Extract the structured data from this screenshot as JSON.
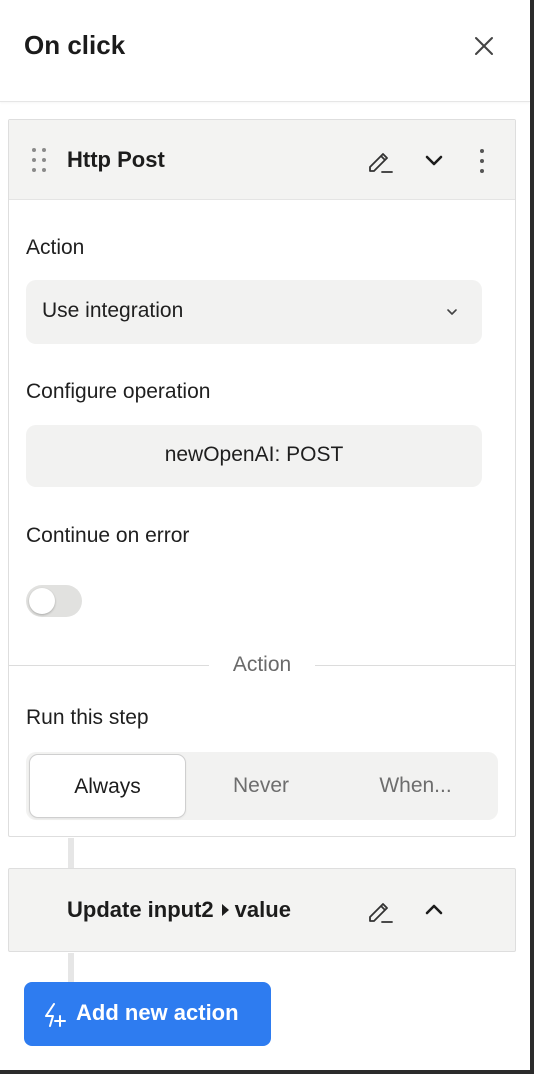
{
  "header": {
    "title": "On click"
  },
  "step": {
    "title": "Http Post",
    "action_label": "Action",
    "action_value": "Use integration",
    "configure_label": "Configure operation",
    "operation_value": "newOpenAI: POST",
    "continue_label": "Continue on error",
    "continue_enabled": false,
    "divider_label": "Action",
    "run_label": "Run this step",
    "run_options": [
      "Always",
      "Never",
      "When..."
    ],
    "run_selected": "Always"
  },
  "next_step": {
    "title_part1": "Update input2",
    "title_part2": "value"
  },
  "footer": {
    "add_label": "Add new action"
  },
  "colors": {
    "accent": "#2e7cf0",
    "card_header": "#f3f3f2",
    "field_bg": "#f2f2f1"
  }
}
